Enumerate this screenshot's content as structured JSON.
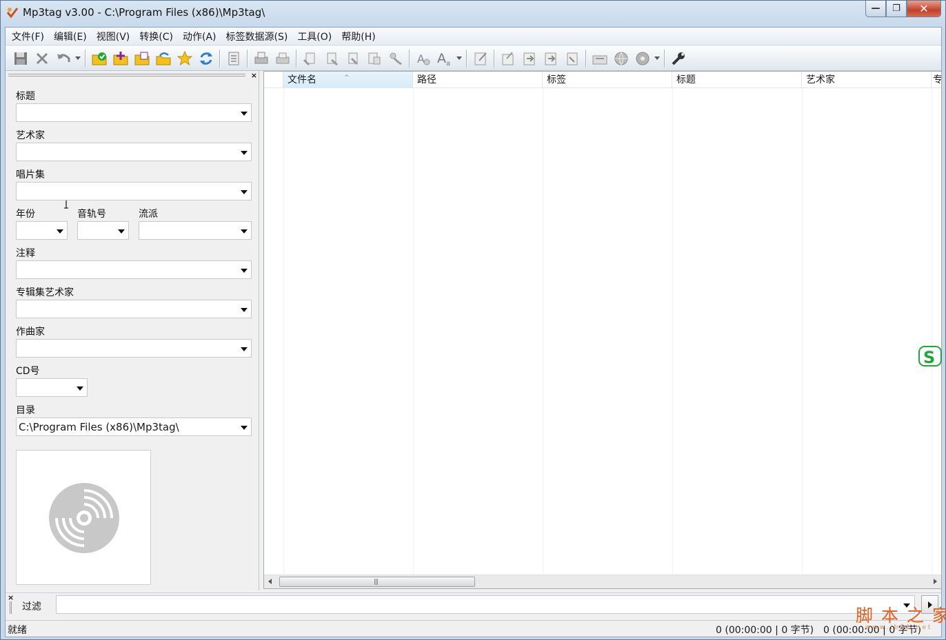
{
  "window": {
    "title": "Mp3tag v3.00  -  C:\\Program Files (x86)\\Mp3tag\\",
    "minimize": "—",
    "maximize": "❐",
    "close": "✕"
  },
  "menu": [
    "文件(F)",
    "编辑(E)",
    "视图(V)",
    "转换(C)",
    "动作(A)",
    "标签数据源(S)",
    "工具(O)",
    "帮助(H)"
  ],
  "toolbar": {
    "icons": [
      "save-icon",
      "remove-tag-icon",
      "undo-icon",
      "change-directory-icon",
      "add-directory-icon",
      "add-folder-icon",
      "playlist-icon",
      "favorite-icon",
      "refresh-icon",
      "extended-tags-icon",
      "print-icon",
      "export-icon",
      "tag-tag-icon",
      "filename-tag-icon",
      "tag-filename-icon",
      "text-tag-icon",
      "auto-number-icon",
      "case-conversion-icon",
      "font-case-icon",
      "edit-icon",
      "tag-sources-icon",
      "freedb-icon",
      "discogs-icon",
      "musicbrainz-icon",
      "web-sources-icon",
      "cd-icon",
      "options-icon"
    ]
  },
  "panel": {
    "close": "×",
    "fields": {
      "title": "标题",
      "artist": "艺术家",
      "album": "唱片集",
      "year": "年份",
      "track": "音轨号",
      "genre": "流派",
      "comment": "注释",
      "album_artist": "专辑集艺术家",
      "composer": "作曲家",
      "cd": "CD号",
      "directory": "目录"
    },
    "directory_value": "C:\\Program Files (x86)\\Mp3tag\\"
  },
  "list": {
    "columns": [
      "文件名",
      "路径",
      "标签",
      "标题",
      "艺术家",
      "专"
    ],
    "scroll_grip": "|||"
  },
  "filter": {
    "close": "×",
    "label": "过滤",
    "value": ""
  },
  "status": {
    "left": "就绪",
    "selected": "0 (00:00:00 | 0 字节)",
    "total": "0 (00:00:00 | 0 字节)"
  },
  "watermark": {
    "text": "脚 本 之 家",
    "sub": "www.jb51.net"
  },
  "colors": {
    "accent_green": "#1ea83a",
    "folder_yellow": "#f2c21b",
    "refresh_blue": "#2a7fd4",
    "watermark_orange": "#e35e1a"
  }
}
